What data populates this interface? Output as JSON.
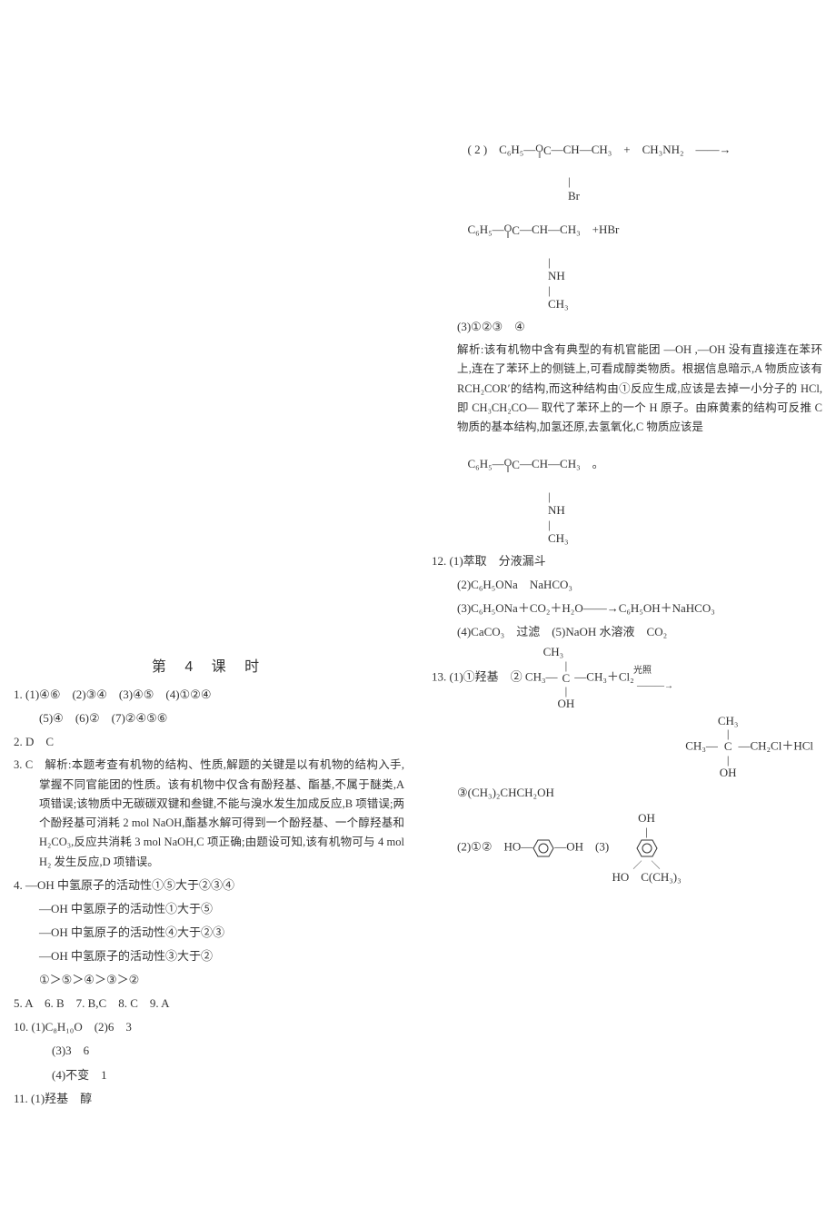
{
  "section_title": "第 4 课 时",
  "left": {
    "q1_line1": "1. (1)④⑥　(2)③④　(3)④⑤　(4)①②④",
    "q1_line2": "(5)④　(6)②　(7)②④⑤⑥",
    "q2": "2. D　C",
    "q3_head": "3. C　解析:本题考查有机物的结构、性质,解题的关键是以有机物的结构入手,掌握不同官能团的性质。该有机物中仅含有酚羟基、酯基,不属于醚类,A 项错误;该物质中无碳碳双键和叁键,不能与溴水发生加成反应,B 项错误;两个酚羟基可消耗 2 mol NaOH,酯基水解可得到一个酚羟基、一个醇羟基和 H₂CO₃,反应共消耗 3 mol NaOH,C 项正确;由题设可知,该有机物可与 4 mol H₂ 发生反应,D 项错误。",
    "q4_l1": "4. —OH 中氢原子的活动性①⑤大于②③④",
    "q4_l2": "—OH 中氢原子的活动性①大于⑤",
    "q4_l3": "—OH 中氢原子的活动性④大于②③",
    "q4_l4": "—OH 中氢原子的活动性③大于②",
    "q4_l5": "①＞⑤＞④＞③＞②",
    "q5_9": "5. A　6. B　7. B,C　8. C　9. A",
    "q10_l1": "10. (1)C₈H₁₀O　(2)6　3",
    "q10_l2": "(3)3　6",
    "q10_l3": "(4)不变　1",
    "q11": "11. (1)羟基　醇"
  },
  "right": {
    "r_eq1_left": "( 2 )　C₆H₅—",
    "r_eq1_mid": "—CH—CH₃　+　CH₃NH₂　——→",
    "r_eq1_br": "Br",
    "r_eq2_left": "C₆H₅—",
    "r_eq2_mid": "—CH—CH₃　+HBr",
    "r_eq2_nh": "NH",
    "r_eq2_ch3": "CH₃",
    "r_3": "(3)①②③　④",
    "r_analysis": "解析:该有机物中含有典型的有机官能团 —OH ,—OH 没有直接连在苯环上,连在了苯环上的侧链上,可看成醇类物质。根据信息暗示,A 物质应该有 RCH₂COR′的结构,而这种结构由①反应生成,应该是去掉一小分子的 HCl,即 CH₃CH₂CO— 取代了苯环上的一个 H 原子。由麻黄素的结构可反推 C 物质的基本结构,加氢还原,去氢氧化,C 物质应该是",
    "r_struct_c6h5": "C₆H₅—",
    "r_struct_chch3": "—CH—CH₃　。",
    "r_struct_nh": "NH",
    "r_struct_ch3": "CH₃",
    "q12_l1": "12. (1)萃取　分液漏斗",
    "q12_l2": "(2)C₆H₅ONa　NaHCO₃",
    "q12_l3": "(3)C₆H₅ONa＋CO₂＋H₂O——→C₆H₅OH＋NaHCO₃",
    "q12_l4": "(4)CaCO₃　过滤　(5)NaOH 水溶液　CO₂",
    "q13_l1a": "13. (1)①羟基　② CH₃—",
    "q13_l1b_top": "CH₃",
    "q13_l1b_mid": "C",
    "q13_l1b_bot": "OH",
    "q13_l1c": "—CH₃＋Cl₂ ",
    "q13_l1_cond": "光照",
    "q13_arrow": "———→",
    "q13_prod_left": "CH₃—",
    "q13_prod_top": "CH₃",
    "q13_prod_mid": "C",
    "q13_prod_bot": "OH",
    "q13_prod_right": "—CH₂Cl＋HCl",
    "q13_l3": "③(CH₃)₂CHCH₂OH",
    "q13_2_a": "(2)①②　HO—",
    "q13_2_b": "—OH　(3)",
    "q13_3_top": "OH",
    "q13_3_bot": "HO　C(CH₃)₃"
  }
}
